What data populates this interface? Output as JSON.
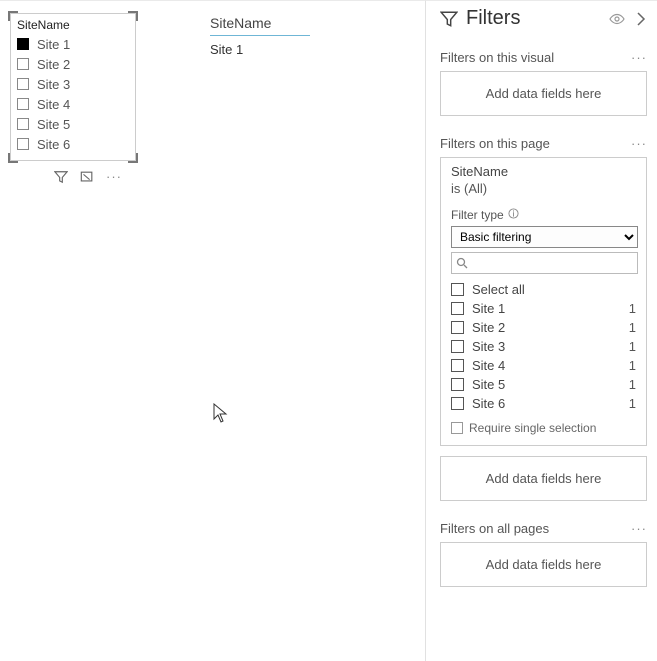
{
  "slicer": {
    "title": "SiteName",
    "items": [
      {
        "label": "Site 1",
        "checked": true
      },
      {
        "label": "Site 2",
        "checked": false
      },
      {
        "label": "Site 3",
        "checked": false
      },
      {
        "label": "Site 4",
        "checked": false
      },
      {
        "label": "Site 5",
        "checked": false
      },
      {
        "label": "Site 6",
        "checked": false
      }
    ]
  },
  "textVisual": {
    "header": "SiteName",
    "value": "Site 1"
  },
  "filters": {
    "panelTitle": "Filters",
    "visual": {
      "label": "Filters on this visual",
      "placeholder": "Add data fields here"
    },
    "page": {
      "label": "Filters on this page",
      "card": {
        "name": "SiteName",
        "state": "is (All)",
        "filterTypeLabel": "Filter type",
        "filterTypeValue": "Basic filtering",
        "searchPlaceholder": "",
        "items": [
          {
            "label": "Select all",
            "count": ""
          },
          {
            "label": "Site 1",
            "count": "1"
          },
          {
            "label": "Site 2",
            "count": "1"
          },
          {
            "label": "Site 3",
            "count": "1"
          },
          {
            "label": "Site 4",
            "count": "1"
          },
          {
            "label": "Site 5",
            "count": "1"
          },
          {
            "label": "Site 6",
            "count": "1"
          }
        ],
        "requireSingle": "Require single selection"
      },
      "placeholder": "Add data fields here"
    },
    "all": {
      "label": "Filters on all pages",
      "placeholder": "Add data fields here"
    }
  }
}
